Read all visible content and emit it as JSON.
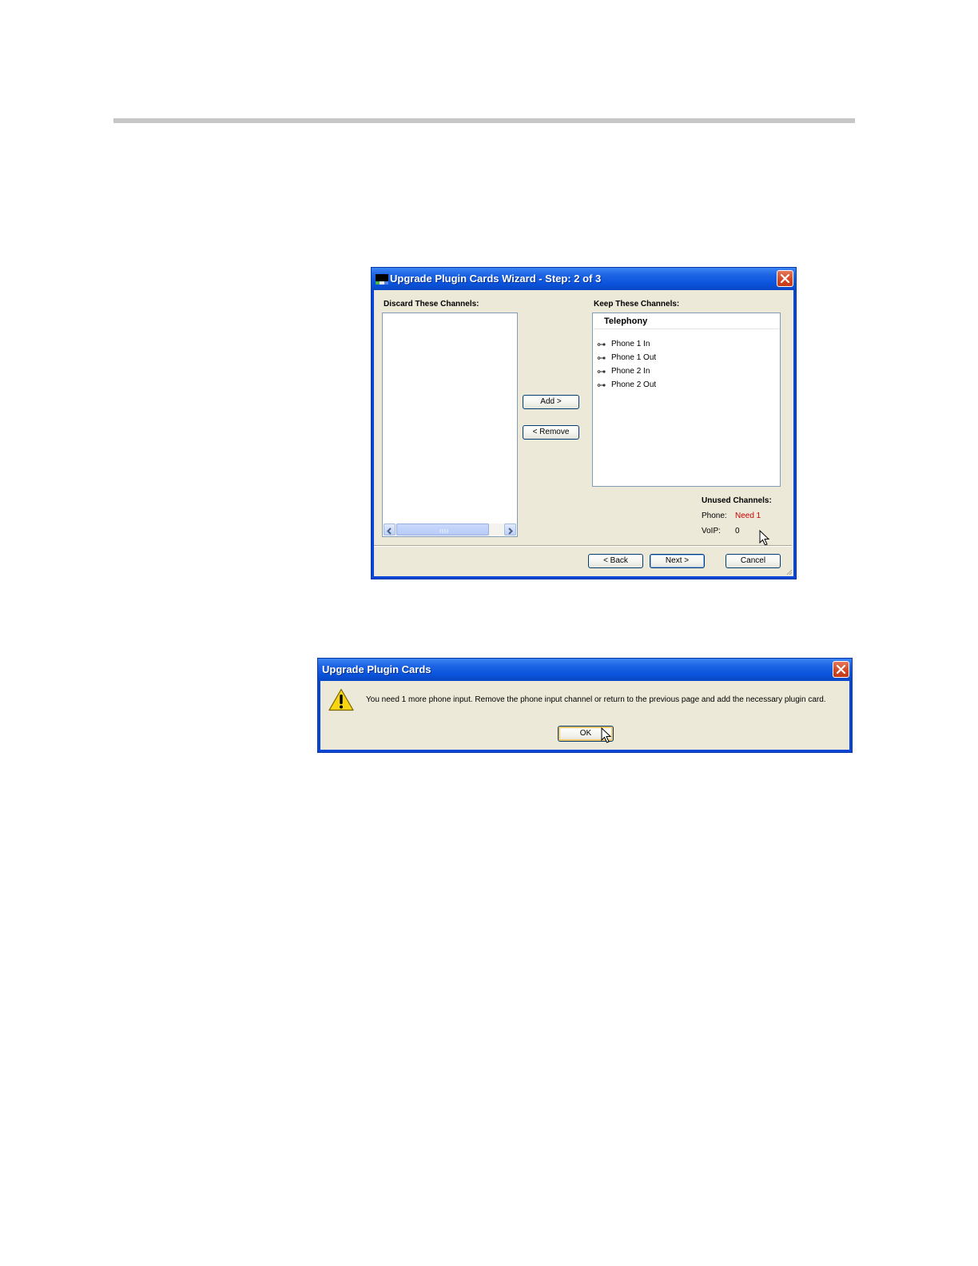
{
  "wizard": {
    "title": "Upgrade Plugin Cards Wizard - Step:  2 of 3",
    "discard_label": "Discard These Channels:",
    "keep_label": "Keep These Channels:",
    "keep_group": "Telephony",
    "channels": [
      "Phone 1 In",
      "Phone 1 Out",
      "Phone 2 In",
      "Phone 2 Out"
    ],
    "add_button": "Add >",
    "remove_button": "< Remove",
    "unused": {
      "heading": "Unused Channels:",
      "phone_label": "Phone:",
      "phone_value": "Need 1",
      "voip_label": "VoIP:",
      "voip_value": "0"
    },
    "back_button": "< Back",
    "next_button": "Next >",
    "cancel_button": "Cancel",
    "icons": [
      "app-icon",
      "close-icon",
      "channel-icon",
      "scroll-left-icon",
      "scroll-right-icon",
      "mouse-cursor-icon"
    ]
  },
  "message_box": {
    "title": "Upgrade Plugin Cards",
    "message": "You need 1 more phone input.  Remove the phone input channel or return to the previous page and add the necessary plugin card.",
    "ok_button": "OK",
    "icons": [
      "warning-icon",
      "close-icon",
      "mouse-cursor-icon"
    ]
  },
  "colors": {
    "xp_title_blue": "#0a54dc",
    "dialog_face": "#ece9d8",
    "need_red": "#cc0000"
  }
}
